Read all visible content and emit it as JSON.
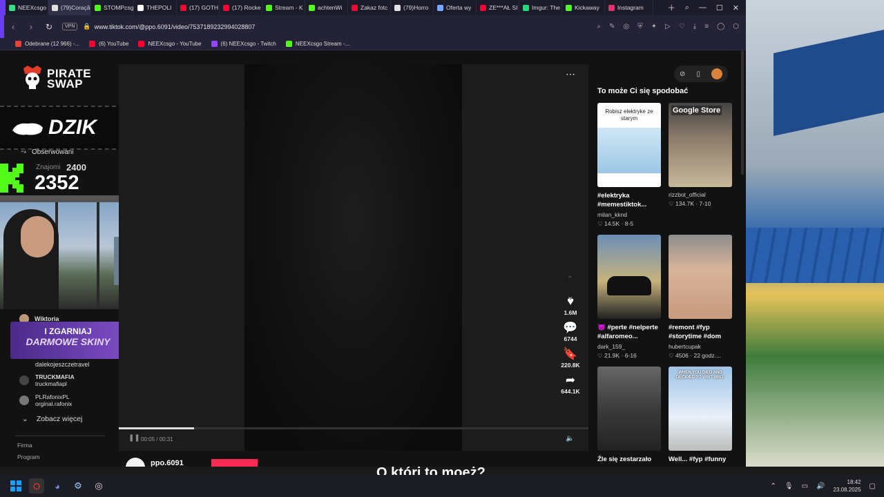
{
  "tabs": [
    {
      "label": "NEEXcsgo",
      "color": "#3ddc84"
    },
    {
      "label": "(79)Coração e",
      "color": "#e0e0e0"
    },
    {
      "label": "STOMPcsg",
      "color": "#53fc18"
    },
    {
      "label": "THEPOLI",
      "color": "#ffffff"
    },
    {
      "label": "(17) GOTH",
      "color": "#ff0033"
    },
    {
      "label": "(17) Rocke",
      "color": "#ff0033"
    },
    {
      "label": "Stream - K",
      "color": "#53fc18"
    },
    {
      "label": "achtenWi",
      "color": "#53fc18"
    },
    {
      "label": "Zakaz fotc",
      "color": "#ff0033"
    },
    {
      "label": "(79)Horro",
      "color": "#e0e0e0"
    },
    {
      "label": "Oferta wy",
      "color": "#7aa7ff"
    },
    {
      "label": "ZE***AŁ SI",
      "color": "#ff0033"
    },
    {
      "label": "Imgur: The",
      "color": "#2cd67a"
    },
    {
      "label": "Kickaway",
      "color": "#53fc18"
    },
    {
      "label": "Instagram",
      "color": "#e1306c"
    }
  ],
  "address": {
    "vpn": "VPN",
    "url": "www.tiktok.com/@ppo.6091/video/7537189232994028807"
  },
  "bookmarks": [
    {
      "label": "Odebrane (12 966) -...",
      "color": "#ea4335"
    },
    {
      "label": "(6) YouTube",
      "color": "#ff0033"
    },
    {
      "label": "NEEXcsgo - YouTube",
      "color": "#ff0033"
    },
    {
      "label": "(6) NEEXcsgo - Twitch",
      "color": "#9146ff"
    },
    {
      "label": "NEEXcsgo Stream -...",
      "color": "#53fc18"
    }
  ],
  "overlay": {
    "pirate1": "PIRATE",
    "pirate2": "SWAP",
    "dzik": "DZIK",
    "counter_small": "2400",
    "counter_big": "2352",
    "skiny1": "I ZGARNIAJ",
    "skiny2": "DARMOWE SKINY"
  },
  "sidebar": {
    "following": "Obserwowani",
    "friends": "Znajomi",
    "accounts": [
      {
        "name": "Wiktoria",
        "handle": ""
      },
      {
        "name": "",
        "handle": "dalekojeszczetravel"
      },
      {
        "name": "TRUCKMAFIA",
        "handle": "truckmafiapl"
      },
      {
        "name": "PLRafonixPL",
        "handle": "orginal.rafonix"
      }
    ],
    "see_more": "Zobacz więcej",
    "footer1": "Firma",
    "footer2": "Program"
  },
  "video": {
    "time": "00:05 / 00:31",
    "progress": 0.16,
    "author": "ppo.6091",
    "likes": "1.6M",
    "comments": "6744",
    "saves": "220.8K",
    "shares": "644.1K"
  },
  "recs": {
    "heading": "To może Ci się spodobać",
    "items": [
      {
        "thumb_text": "Robisz elektryke ze starym",
        "title": "#elektryka #memestiktok...",
        "user": "milan_kknd",
        "likes": "14.5K",
        "date": "8-5"
      },
      {
        "thumb_text": "Google Store",
        "title": "",
        "user": "rizzbot_official",
        "likes": "134.7K",
        "date": "7-10"
      },
      {
        "thumb_text": "",
        "title": "😈 #perte #nelperte #alfaromeo...",
        "user": "dark_159_",
        "likes": "21.9K",
        "date": "6-16"
      },
      {
        "thumb_text": "",
        "title": "#remont #fyp #storytime #dom",
        "user": "hubertcupak",
        "likes": "4506",
        "date": "22 godz...."
      },
      {
        "thumb_text": "",
        "title": "Źle się zestarzało",
        "user": "",
        "likes": "",
        "date": ""
      },
      {
        "thumb_text": "WHEN YOU DIED AND DECIDED TO VISIT BRO:",
        "title": "Well... #fyp #funny",
        "user": "",
        "likes": "",
        "date": ""
      }
    ]
  },
  "subtitle": "O którj to moeż?",
  "clock": {
    "time": "18:42",
    "date": "23.08.2025"
  }
}
